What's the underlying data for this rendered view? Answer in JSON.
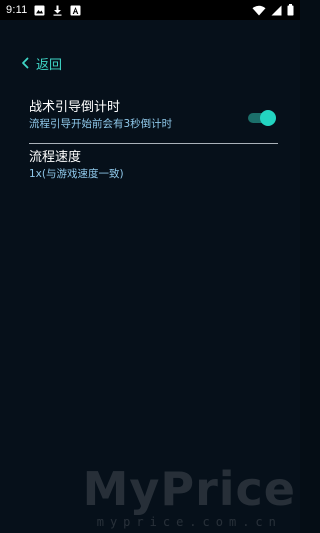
{
  "status_bar": {
    "time": "9:11",
    "left_icons": [
      "image-icon",
      "download-icon",
      "a-icon"
    ],
    "right_icons": [
      "wifi-icon",
      "signal-icon",
      "battery-icon"
    ]
  },
  "nav": {
    "back_label": "返回"
  },
  "settings": [
    {
      "title": "战术引导倒计时",
      "subtitle": "流程引导开始前会有3秒倒计时",
      "toggle_on": true
    },
    {
      "title": "流程速度",
      "subtitle": "1x(与游戏速度一致)"
    }
  ],
  "colors": {
    "background": "#06101a",
    "accent": "#3fd6c7",
    "subtitle": "#8fc8ea",
    "toggle_thumb": "#23d4c1",
    "toggle_track": "#1b6f6a"
  },
  "watermark": {
    "logo": "MyPrice",
    "url": "myprice.com.cn"
  }
}
